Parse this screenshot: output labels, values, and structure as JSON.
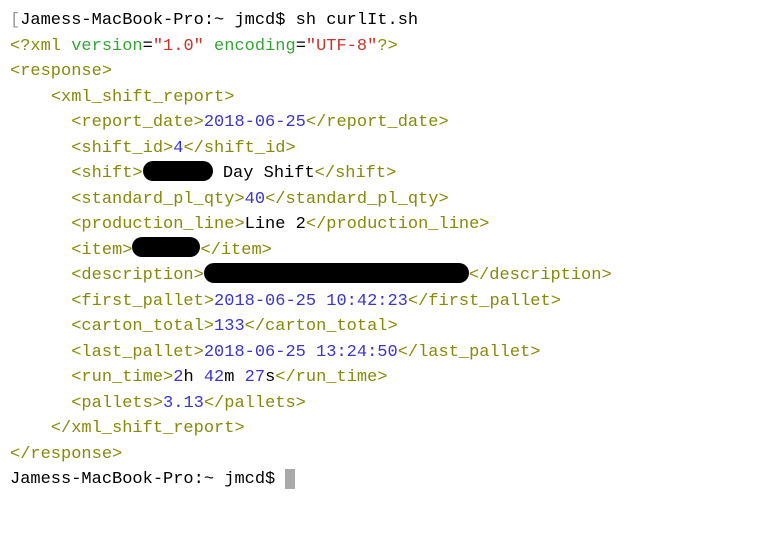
{
  "prompt1": {
    "bracket": "[",
    "host": "Jamess-MacBook-Pro:~",
    "user": "jmcd$",
    "command": "sh curlIt.sh"
  },
  "xml": {
    "pi_open": "<?xml ",
    "attr_version_name": "version",
    "attr_version_val": "\"1.0\"",
    "attr_encoding_name": " encoding",
    "attr_encoding_val": "\"UTF-8\"",
    "pi_close": "?>",
    "response_open": "<response>",
    "xsr_open": "<xml_shift_report>",
    "report_date": {
      "open": "<report_date>",
      "val": "2018-06-25",
      "close": "</report_date>"
    },
    "shift_id": {
      "open": "<shift_id>",
      "val": "4",
      "close": "</shift_id>"
    },
    "shift": {
      "open": "<shift>",
      "text": " Day Shift",
      "close": "</shift>"
    },
    "std_qty": {
      "open": "<standard_pl_qty>",
      "val": "40",
      "close": "</standard_pl_qty>"
    },
    "prod_line": {
      "open": "<production_line>",
      "text": "Line 2",
      "close": "</production_line>"
    },
    "item": {
      "open": "<item>",
      "close": "</item>"
    },
    "description": {
      "open": "<description>",
      "close": "</description>"
    },
    "first_pallet": {
      "open": "<first_pallet>",
      "val": "2018-06-25 10:42:23",
      "close": "</first_pallet>"
    },
    "carton_total": {
      "open": "<carton_total>",
      "val": "133",
      "close": "</carton_total>"
    },
    "last_pallet": {
      "open": "<last_pallet>",
      "val": "2018-06-25 13:24:50",
      "close": "</last_pallet>"
    },
    "run_time": {
      "open": "<run_time>",
      "h": "2",
      "h_unit": "h ",
      "m": "42",
      "m_unit": "m ",
      "s": "27",
      "s_unit": "s",
      "close": "</run_time>"
    },
    "pallets": {
      "open": "<pallets>",
      "val": "3.13",
      "close": "</pallets>"
    },
    "xsr_close": "</xml_shift_report>",
    "response_close": "</response>"
  },
  "prompt2": {
    "host": "Jamess-MacBook-Pro:~",
    "user": "jmcd$"
  },
  "indent": {
    "l1": "  ",
    "l2": "    ",
    "l3": "      "
  }
}
